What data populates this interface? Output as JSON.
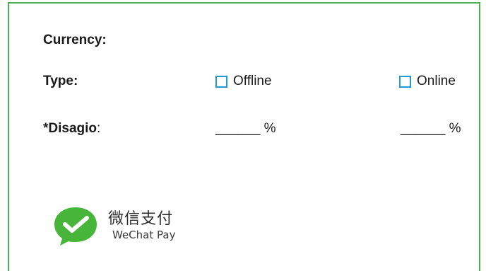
{
  "form": {
    "currency": {
      "label": "Currency",
      "colon": ":"
    },
    "type": {
      "label": "Type",
      "colon": ":",
      "options": [
        {
          "label": "Offline",
          "checked": false
        },
        {
          "label": "Online",
          "checked": false
        }
      ]
    },
    "disagio": {
      "label": "*Disagio",
      "colon": ":",
      "offline_value": "______ %",
      "online_value": "______ %"
    }
  },
  "logo": {
    "chinese_text": "微信支付",
    "english_text": "WeChat Pay",
    "icon": "wechat-pay-icon",
    "brand_color": "#4caf50"
  },
  "colors": {
    "border": "#4caf50",
    "checkbox_border": "#1f9ad6"
  }
}
